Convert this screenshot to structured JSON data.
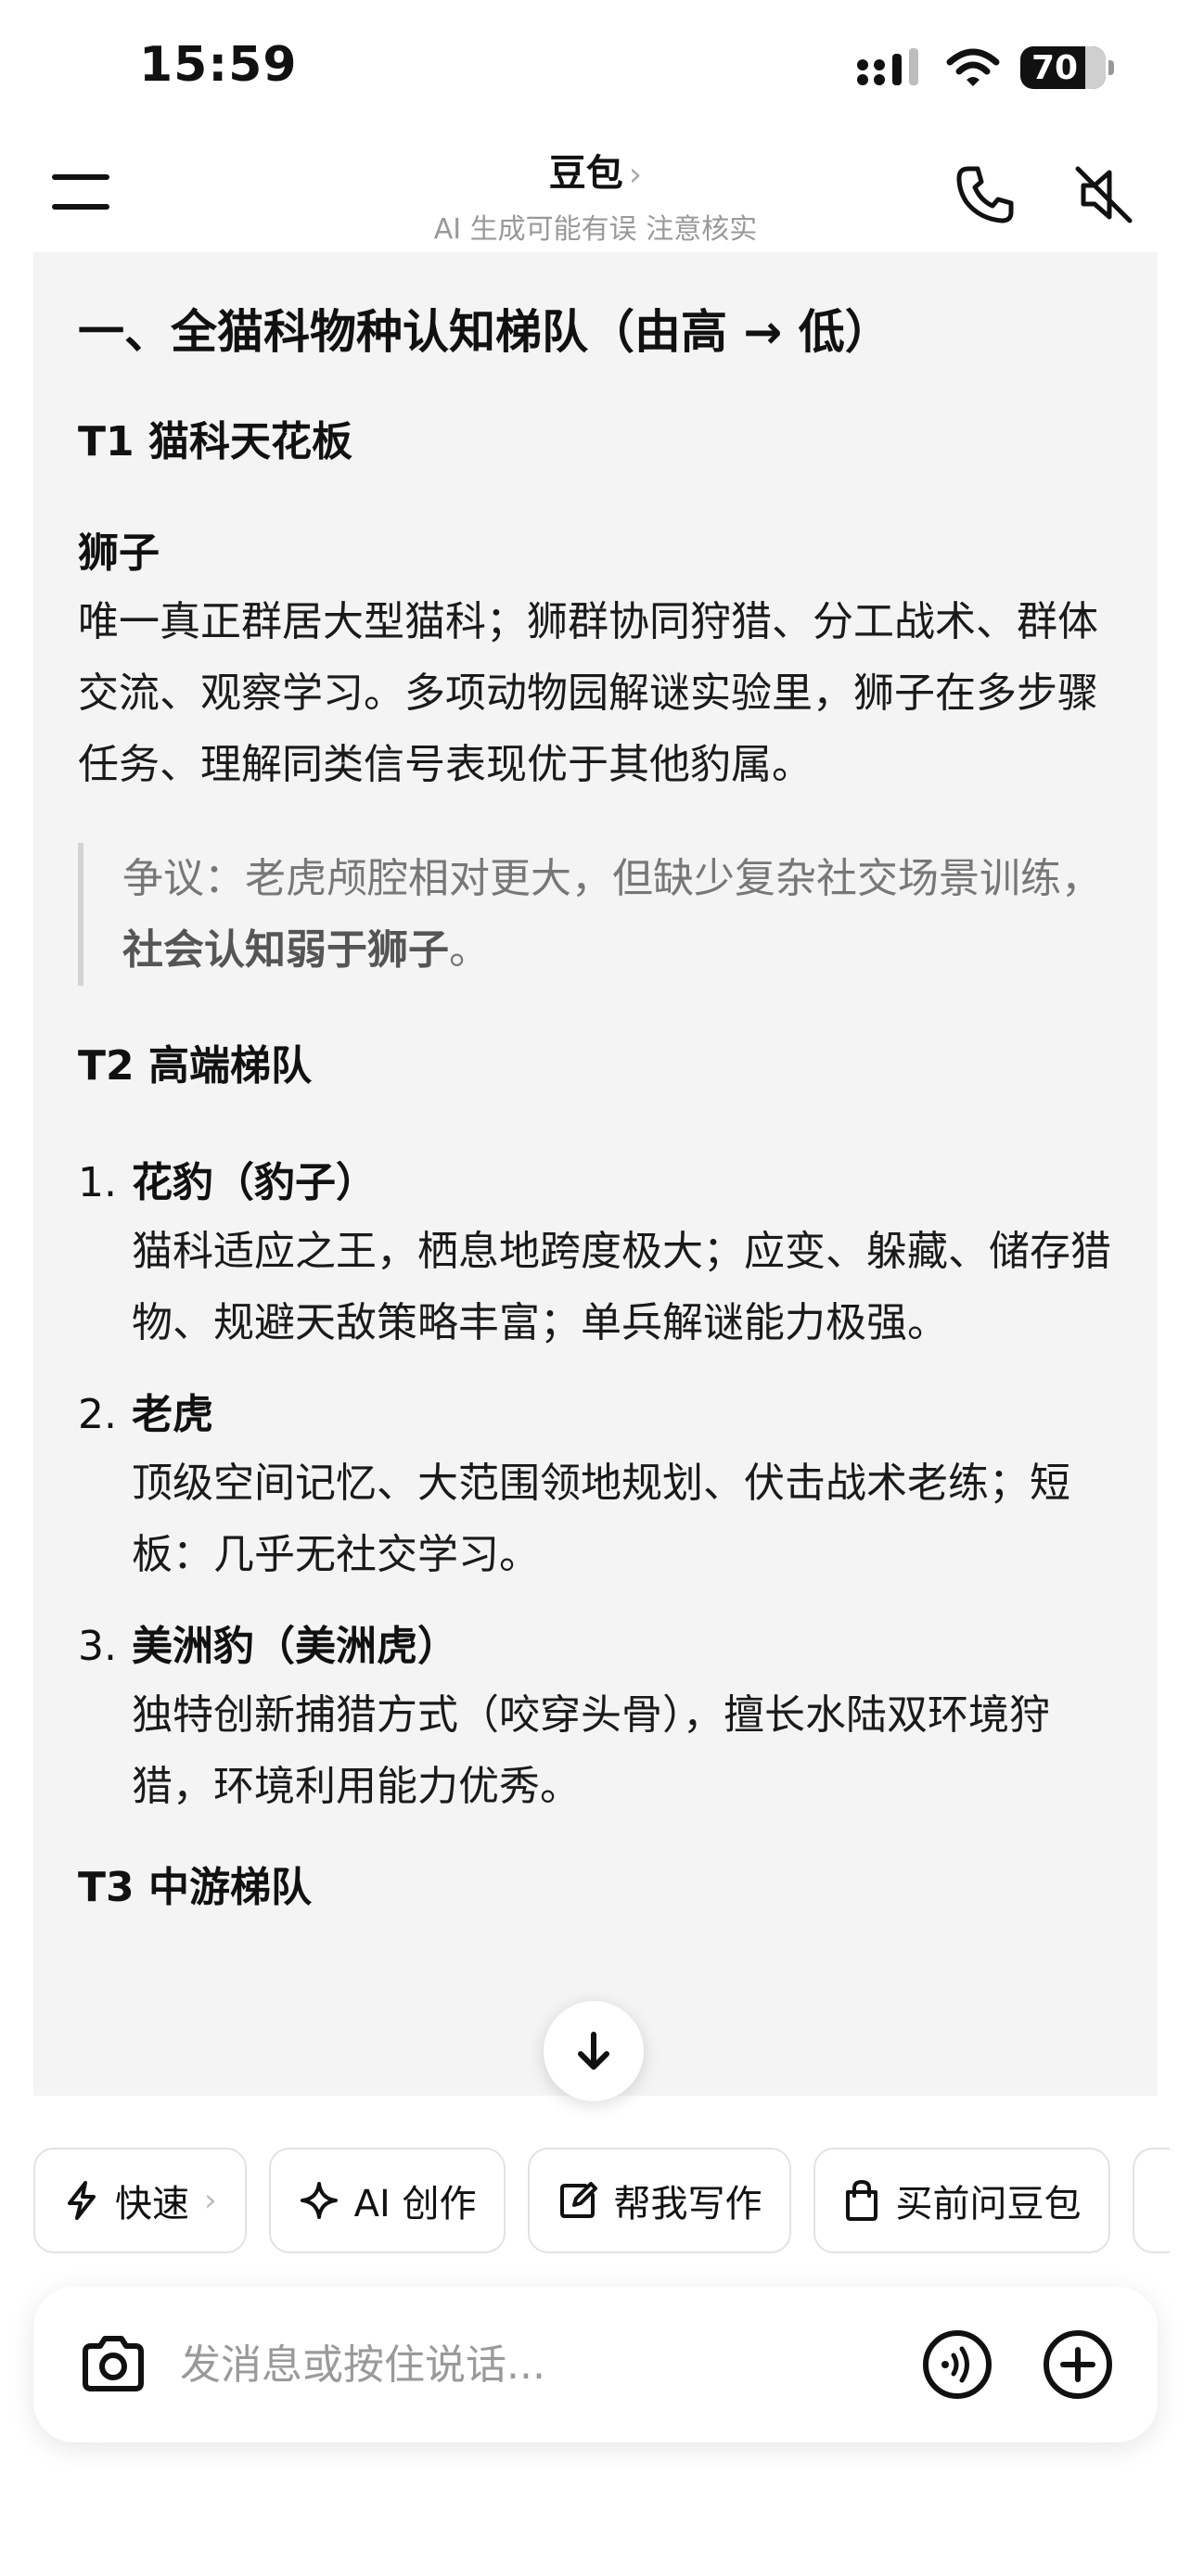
{
  "status_bar": {
    "time": "15:59",
    "battery": "70"
  },
  "header": {
    "title": "豆包",
    "title_chevron": "›",
    "subtitle": "AI 生成可能有误 注意核实"
  },
  "content": {
    "heading": "一、全猫科物种认知梯队（由高 → 低）",
    "t1": {
      "title": "T1 猫科天花板",
      "subject": "狮子",
      "text": "唯一真正群居大型猫科；狮群协同狩猎、分工战术、群体交流、观察学习。多项动物园解谜实验里，狮子在多步骤任务、理解同类信号表现优于其他豹属。",
      "quote_plain": "争议：老虎颅腔相对更大，但缺少复杂社交场景训练，",
      "quote_bold": "社会认知弱于狮子",
      "quote_end": "。"
    },
    "t2": {
      "title": "T2 高端梯队",
      "items": [
        {
          "num": "1.",
          "name": "花豹（豹子）",
          "desc": "猫科适应之王，栖息地跨度极大；应变、躲藏、储存猎物、规避天敌策略丰富；单兵解谜能力极强。"
        },
        {
          "num": "2.",
          "name": "老虎",
          "desc": "顶级空间记忆、大范围领地规划、伏击战术老练；短板：几乎无社交学习。"
        },
        {
          "num": "3.",
          "name": "美洲豹（美洲虎）",
          "desc": "独特创新捕猎方式（咬穿头骨），擅长水陆双环境狩猎，环境利用能力优秀。"
        }
      ]
    },
    "t3": {
      "title": "T3 中游梯队"
    }
  },
  "chips": [
    {
      "label": "快速",
      "icon": "lightning-icon",
      "chevron": "›"
    },
    {
      "label": "AI 创作",
      "icon": "sparkle-icon"
    },
    {
      "label": "帮我写作",
      "icon": "edit-icon"
    },
    {
      "label": "买前问豆包",
      "icon": "shopping-bag-icon"
    }
  ],
  "input": {
    "placeholder": "发消息或按住说话..."
  },
  "colors": {
    "card_bg": "#f4f4f4",
    "quote_bar": "#d3d3d3",
    "text": "#111111",
    "muted": "#999999"
  }
}
